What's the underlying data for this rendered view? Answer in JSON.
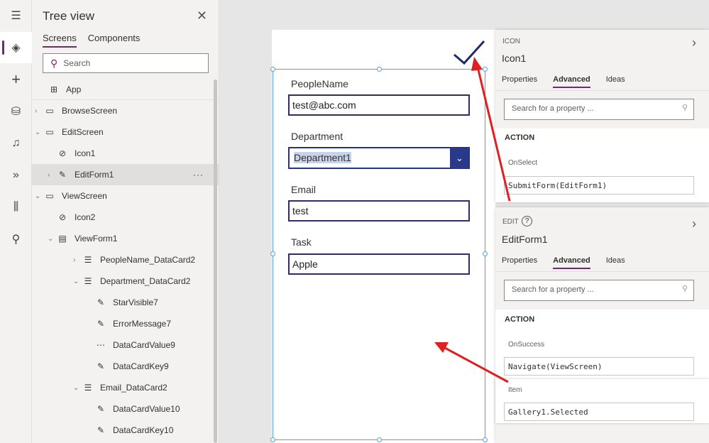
{
  "rail": {
    "items": [
      {
        "icon": "hamburger-icon"
      },
      {
        "icon": "layers-icon",
        "active": true
      },
      {
        "icon": "plus-icon"
      },
      {
        "icon": "database-icon"
      },
      {
        "icon": "media-icon"
      },
      {
        "icon": "power-automate-icon"
      },
      {
        "icon": "tools-icon"
      },
      {
        "icon": "search-icon"
      }
    ]
  },
  "tree": {
    "title": "Tree view",
    "tabs": [
      "Screens",
      "Components"
    ],
    "search_placeholder": "Search",
    "rows": [
      {
        "label": "App",
        "level": 0,
        "icon": "app-icon"
      },
      {
        "label": "BrowseScreen",
        "level": 0,
        "icon": "screen-icon",
        "chevron": "›"
      },
      {
        "label": "EditScreen",
        "level": 0,
        "icon": "screen-icon",
        "chevron": "⌄"
      },
      {
        "label": "Icon1",
        "level": 1,
        "icon": "icon-control-icon"
      },
      {
        "label": "EditForm1",
        "level": 1,
        "icon": "edit-form-icon",
        "chevron": "›",
        "selected": true,
        "more": "···"
      },
      {
        "label": "ViewScreen",
        "level": 0,
        "icon": "screen-icon",
        "chevron": "⌄"
      },
      {
        "label": "Icon2",
        "level": 1,
        "icon": "icon-control-icon"
      },
      {
        "label": "ViewForm1",
        "level": 1,
        "icon": "view-form-icon",
        "chevron": "⌄"
      },
      {
        "label": "PeopleName_DataCard2",
        "level": 2,
        "icon": "datacard-icon",
        "chevron": "›"
      },
      {
        "label": "Department_DataCard2",
        "level": 2,
        "icon": "datacard-icon",
        "chevron": "⌄"
      },
      {
        "label": "StarVisible7",
        "level": 3,
        "icon": "label-icon"
      },
      {
        "label": "ErrorMessage7",
        "level": 3,
        "icon": "label-icon"
      },
      {
        "label": "DataCardValue9",
        "level": 3,
        "icon": "textinput-icon"
      },
      {
        "label": "DataCardKey9",
        "level": 3,
        "icon": "label-icon"
      },
      {
        "label": "Email_DataCard2",
        "level": 2,
        "icon": "datacard-icon",
        "chevron": "⌄"
      },
      {
        "label": "DataCardValue10",
        "level": 3,
        "icon": "label-icon"
      },
      {
        "label": "DataCardKey10",
        "level": 3,
        "icon": "label-icon"
      }
    ]
  },
  "form": {
    "fields": [
      {
        "label": "PeopleName",
        "value": "test@abc.com",
        "type": "text"
      },
      {
        "label": "Department",
        "value": "Department1",
        "type": "dropdown"
      },
      {
        "label": "Email",
        "value": "test",
        "type": "text"
      },
      {
        "label": "Task",
        "value": "Apple",
        "type": "text"
      }
    ]
  },
  "icon_panel": {
    "type": "ICON",
    "name": "Icon1",
    "tabs": [
      "Properties",
      "Advanced",
      "Ideas"
    ],
    "search_placeholder": "Search for a property ...",
    "section": "ACTION",
    "property": "OnSelect",
    "formula": "SubmitForm(EditForm1)"
  },
  "edit_panel": {
    "type": "EDIT",
    "help": "?",
    "name": "EditForm1",
    "tabs": [
      "Properties",
      "Advanced",
      "Ideas"
    ],
    "search_placeholder": "Search for a property ...",
    "section": "ACTION",
    "property": "OnSuccess",
    "formula": "Navigate(ViewScreen)",
    "property2": "Item",
    "formula2": "Gallery1.Selected"
  },
  "colors": {
    "accent": "#742774",
    "form_border": "#2a2f6a",
    "arrow": "#e02020",
    "selection": "#5aa0e0"
  }
}
